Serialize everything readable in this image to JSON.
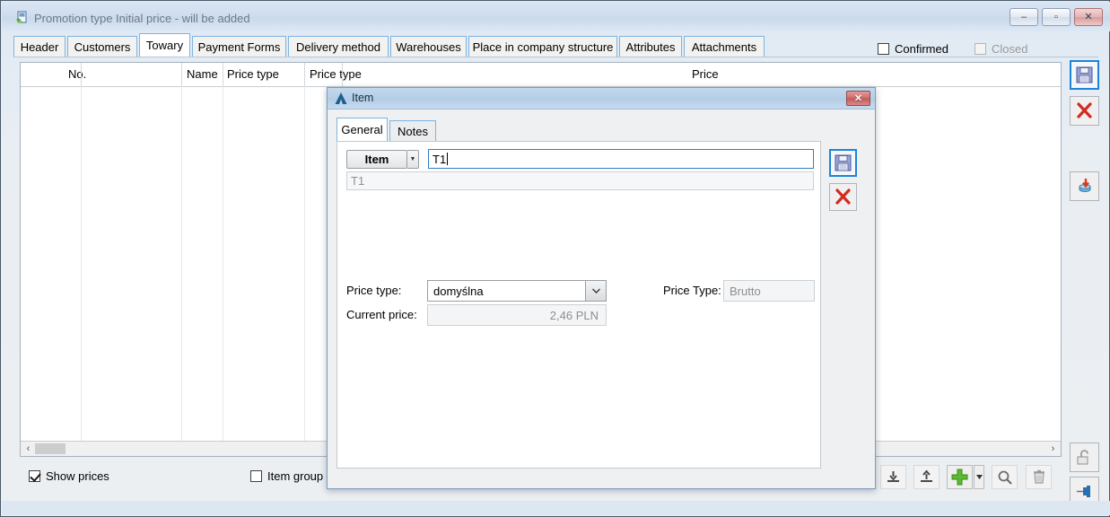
{
  "window": {
    "title": "Promotion type Initial price - will be added",
    "icon": "document-leaf-icon",
    "controls": [
      {
        "name": "minimize-button",
        "glyph": "–"
      },
      {
        "name": "maximize-button",
        "glyph": "▫"
      },
      {
        "name": "close-button",
        "glyph": "✕"
      }
    ]
  },
  "tabs": [
    {
      "label": "Header",
      "active": false
    },
    {
      "label": "Customers",
      "active": false
    },
    {
      "label": "Towary",
      "active": true
    },
    {
      "label": "Payment Forms",
      "active": false
    },
    {
      "label": "Delivery method",
      "active": false
    },
    {
      "label": "Warehouses",
      "active": false
    },
    {
      "label": "Place in company structure",
      "active": false
    },
    {
      "label": "Attributes",
      "active": false
    },
    {
      "label": "Attachments",
      "active": false
    }
  ],
  "header_options": [
    {
      "label": "Confirmed",
      "checked": false,
      "disabled": false
    },
    {
      "label": "Closed",
      "checked": false,
      "disabled": true
    }
  ],
  "grid": {
    "columns": [
      "No.",
      "Name",
      "Price type",
      "Price type",
      "Price"
    ],
    "rows": [],
    "scroll_left_glyph": "‹",
    "scroll_right_glyph": "›"
  },
  "bottom": {
    "show_prices": {
      "label": "Show prices",
      "checked": true
    },
    "item_group": {
      "label": "Item group",
      "checked": false
    },
    "toolbar": [
      {
        "name": "import-button",
        "icon": "arrow-down-into-tray-icon"
      },
      {
        "name": "export-button",
        "icon": "arrow-up-out-of-tray-icon"
      },
      {
        "name": "add-button",
        "icon": "green-plus-icon"
      },
      {
        "name": "add-dropdown-button",
        "icon": "chevron-down-icon"
      },
      {
        "name": "search-button",
        "icon": "magnifier-icon"
      },
      {
        "name": "delete-button",
        "icon": "trash-icon"
      }
    ]
  },
  "rail": [
    {
      "name": "save-button",
      "icon": "floppy-disk-icon",
      "primary": true
    },
    {
      "name": "cancel-button",
      "icon": "red-x-icon",
      "primary": false
    },
    {
      "name": "database-button",
      "icon": "database-arrow-icon",
      "primary": false
    },
    {
      "name": "unlock-button",
      "icon": "open-padlock-icon",
      "primary": false
    },
    {
      "name": "pin-button",
      "icon": "pin-icon",
      "primary": false
    }
  ],
  "dialog": {
    "title": "Item",
    "icon": "blue-triangle-icon",
    "close_glyph": "✕",
    "tabs": [
      {
        "label": "General",
        "active": true
      },
      {
        "label": "Notes",
        "active": false
      }
    ],
    "item_button": "Item",
    "item_dropdown_glyph": "▼",
    "item_value": "T1",
    "item_subtext": "T1",
    "price_type_label": "Price type:",
    "price_type_value": "domyślna",
    "price_type_arrow": "▼",
    "current_price_label": "Current price:",
    "current_price_value": "2,46 PLN",
    "price_type2_label": "Price Type:",
    "price_type2_value": "Brutto",
    "buttons": [
      {
        "name": "dialog-save-button",
        "icon": "floppy-disk-icon",
        "primary": true
      },
      {
        "name": "dialog-cancel-button",
        "icon": "red-x-icon",
        "primary": false
      }
    ]
  }
}
